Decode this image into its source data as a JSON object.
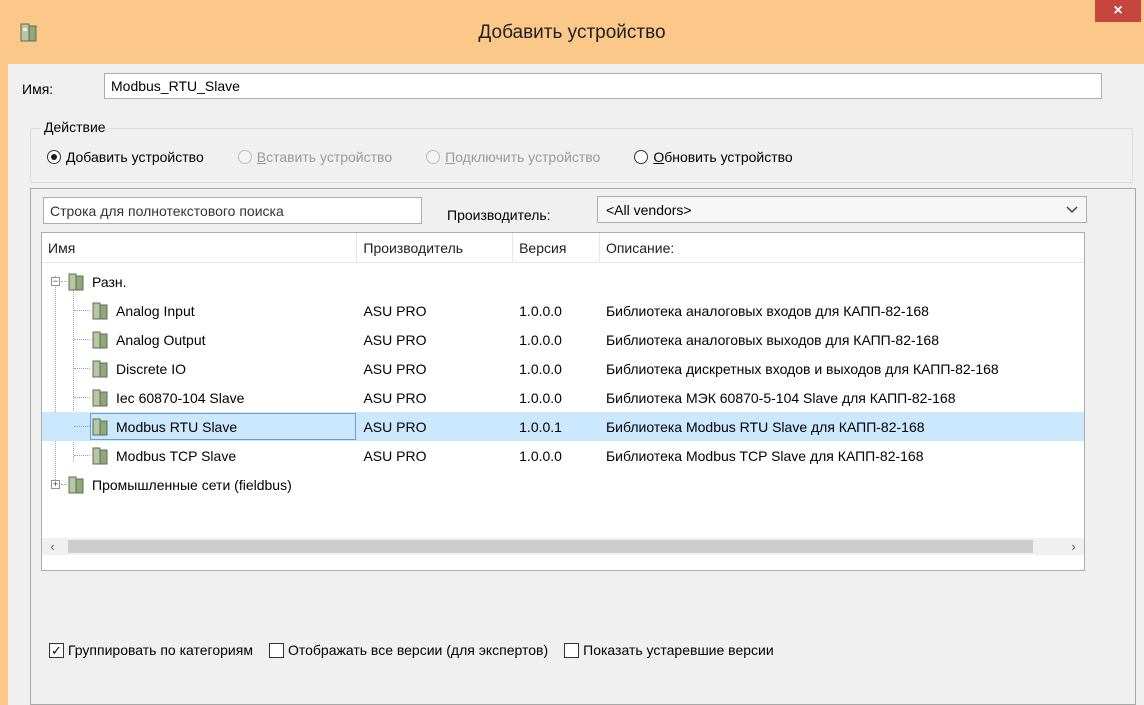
{
  "window": {
    "title": "Добавить устройство",
    "close_glyph": "×",
    "title_color": "#fbc88a",
    "close_color": "#c7453f"
  },
  "name": {
    "label": "Имя:",
    "value": "Modbus_RTU_Slave"
  },
  "action": {
    "legend": "Действие",
    "options": [
      {
        "label_underlined": "Д",
        "label_rest": "обавить устройство",
        "checked": true,
        "disabled": false
      },
      {
        "label_underlined": "В",
        "label_rest": "ставить устройство",
        "checked": false,
        "disabled": true
      },
      {
        "label_underlined": "П",
        "label_rest": "одключить устройство",
        "checked": false,
        "disabled": true
      },
      {
        "label_underlined": "О",
        "label_rest": "бновить устройство",
        "checked": false,
        "disabled": false
      }
    ]
  },
  "search": {
    "value": "Строка для полнотекстового поиска"
  },
  "vendor": {
    "label": "Производитель:",
    "selected": "<All vendors>"
  },
  "table": {
    "headers": [
      "Имя",
      "Производитель",
      "Версия",
      "Описание:"
    ],
    "groups": [
      {
        "name": "Разн.",
        "expander": "−",
        "items": [
          {
            "name": "Analog Input",
            "vendor": "ASU PRO",
            "version": "1.0.0.0",
            "description": "Библиотека аналоговых входов для КАПП-82-168"
          },
          {
            "name": "Analog Output",
            "vendor": "ASU PRO",
            "version": "1.0.0.0",
            "description": "Библиотека аналоговых выходов для КАПП-82-168"
          },
          {
            "name": "Discrete IO",
            "vendor": "ASU PRO",
            "version": "1.0.0.0",
            "description": "Библиотека дискретных входов и выходов для КАПП-82-168"
          },
          {
            "name": "Iec 60870-104 Slave",
            "vendor": "ASU PRO",
            "version": "1.0.0.0",
            "description": "Библиотека МЭК 60870-5-104 Slave для КАПП-82-168"
          },
          {
            "name": "Modbus RTU Slave",
            "vendor": "ASU PRO",
            "version": "1.0.0.1",
            "description": "Библиотека Modbus RTU Slave для КАПП-82-168",
            "selected": true
          },
          {
            "name": "Modbus TCP Slave",
            "vendor": "ASU PRO",
            "version": "1.0.0.0",
            "description": "Библиотека Modbus TCP Slave для КАПП-82-168"
          }
        ]
      },
      {
        "name": "Промышленные сети (fieldbus)",
        "expander": "+",
        "items": []
      }
    ],
    "scroll_left": "‹",
    "scroll_right": "›"
  },
  "options": [
    {
      "label": "Группировать по категориям",
      "checked": true
    },
    {
      "label": "Отображать все версии (для экспертов)",
      "checked": false
    },
    {
      "label": "Показать устаревшие версии",
      "checked": false
    }
  ],
  "colors": {
    "selection": "#cce8ff",
    "dialog_bg": "#f0f0f0"
  }
}
